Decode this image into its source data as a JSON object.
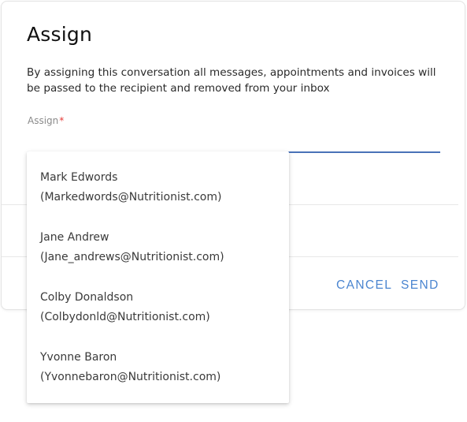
{
  "dialog": {
    "title": "Assign",
    "description": "By assigning this conversation all messages, appointments and invoices will be passed to the recipient and removed from your inbox",
    "field": {
      "label": "Assign",
      "required_mark": "*",
      "value": ""
    },
    "buttons": {
      "cancel": "CANCEL",
      "send": "SEND"
    },
    "accent_color": "#4a72b8",
    "button_color": "#4a85d0",
    "required_color": "#e53935"
  },
  "dropdown": {
    "options": [
      {
        "name": "Mark Edwords",
        "email": "(Markedwords@Nutritionist.com)"
      },
      {
        "name": "Jane Andrew",
        "email": "(Jane_andrews@Nutritionist.com)"
      },
      {
        "name": "Colby Donaldson",
        "email": "(Colbydonld@Nutritionist.com)"
      },
      {
        "name": "Yvonne Baron",
        "email": "(Yvonnebaron@Nutritionist.com)"
      }
    ]
  }
}
